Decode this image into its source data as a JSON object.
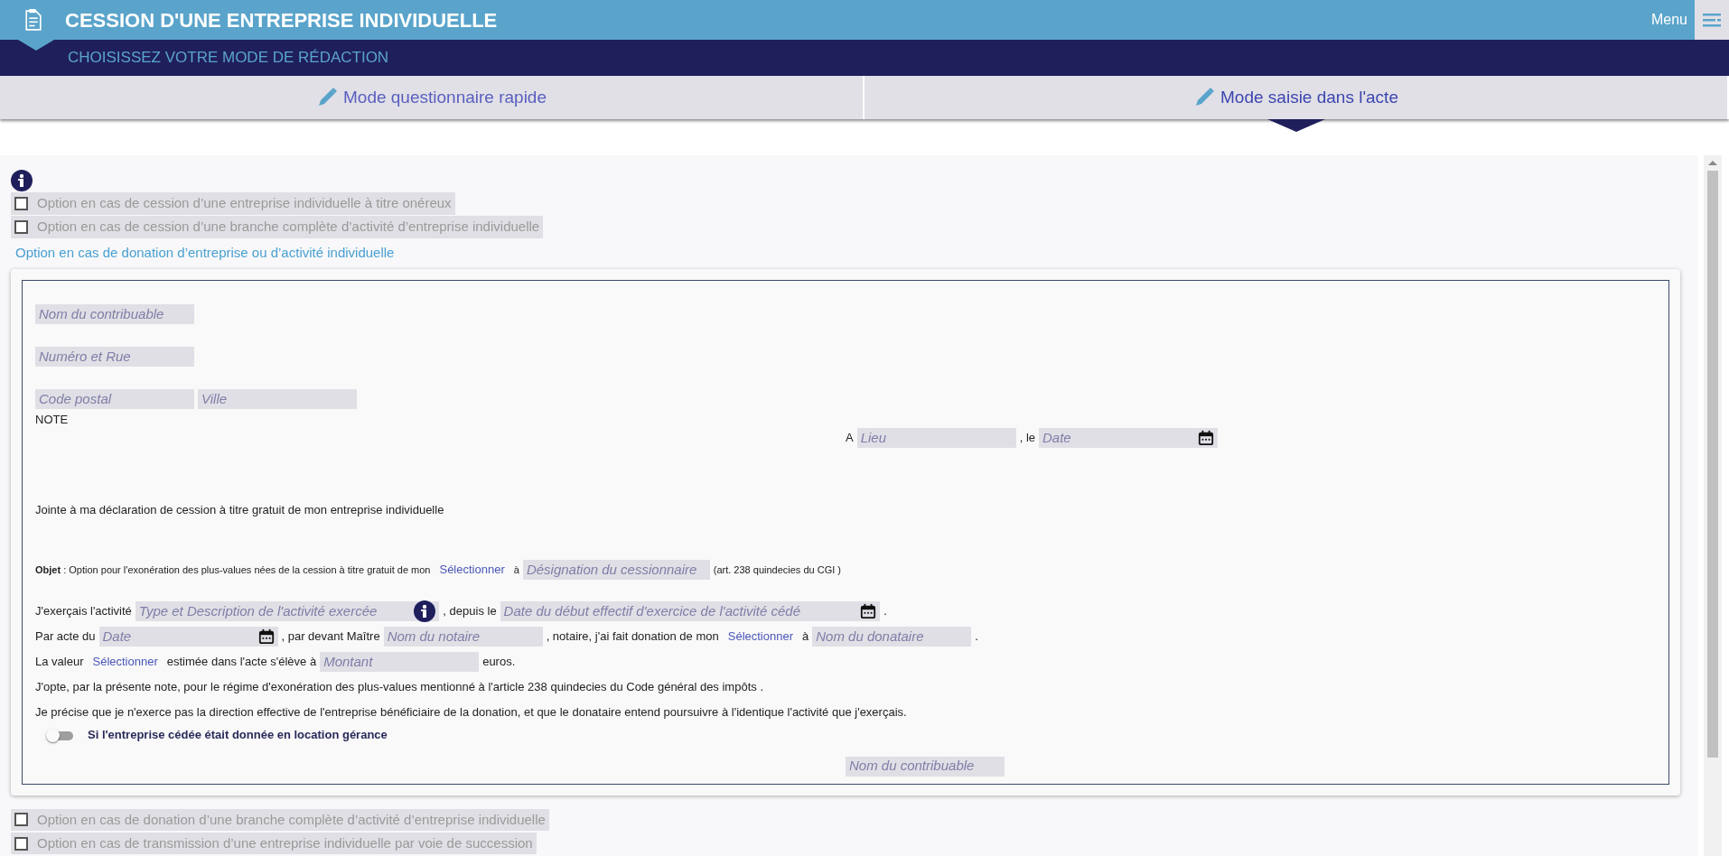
{
  "header": {
    "title": "CESSION D'UNE ENTREPRISE INDIVIDUELLE",
    "menu_label": "Menu"
  },
  "subheader": "CHOISISSEZ VOTRE MODE DE RÉDACTION",
  "tabs": [
    {
      "label": "Mode questionnaire rapide",
      "selected": false
    },
    {
      "label": "Mode saisie dans l'acte",
      "selected": true
    }
  ],
  "options_before": [
    {
      "label": "Option en cas de cession d’une entreprise individuelle à titre onéreux",
      "checked": false
    },
    {
      "label": "Option en cas de cession d’une branche complète d’activité d’entreprise individuelle",
      "checked": false
    }
  ],
  "section_title": "Option en cas de donation d’entreprise ou d’activité individuelle",
  "form": [
    {
      "kind": "fields",
      "segments": [
        {
          "kind": "field",
          "placeholder": "Nom du contribuable"
        }
      ]
    },
    {
      "kind": "fields",
      "segments": [
        {
          "kind": "field",
          "placeholder": "Numéro et Rue"
        }
      ]
    },
    {
      "kind": "fields",
      "segments": [
        {
          "kind": "field",
          "placeholder": "Code postal"
        },
        {
          "kind": "field",
          "placeholder": "Ville"
        }
      ]
    },
    {
      "kind": "heading",
      "segments": [
        {
          "kind": "text",
          "text": "NOTE"
        }
      ]
    },
    {
      "kind": "place_date",
      "segments": [
        {
          "kind": "text",
          "text": "A"
        },
        {
          "kind": "field",
          "placeholder": "Lieu"
        },
        {
          "kind": "text",
          "text": ", le"
        },
        {
          "kind": "date",
          "placeholder": "Date"
        }
      ]
    },
    {
      "kind": "intro",
      "segments": [
        {
          "kind": "text",
          "text": "Jointe à ma déclaration de cession à titre gratuit de mon entreprise individuelle"
        }
      ]
    },
    {
      "kind": "subject",
      "segments": [
        {
          "kind": "text",
          "text": "**Objet** : Option pour l'exonération des plus-values nées de la cession à titre gratuit de mon"
        },
        {
          "kind": "select",
          "text": "Sélectionner"
        },
        {
          "kind": "text",
          "text": "à"
        },
        {
          "kind": "field",
          "placeholder": "Désignation du cessionnaire"
        },
        {
          "kind": "text",
          "text": "(art. 238 quindecies du CGI )"
        }
      ]
    },
    {
      "kind": "paragraph",
      "segments": [
        {
          "kind": "text",
          "text": "J'exerçais l'activité"
        },
        {
          "kind": "info_field",
          "placeholder": "Type et Description de l'activité exercée"
        },
        {
          "kind": "text",
          "text": ", depuis le"
        },
        {
          "kind": "date",
          "placeholder": "Date du début effectif d'exercice de l'activité cédé"
        },
        {
          "kind": "text",
          "text": "."
        }
      ]
    },
    {
      "kind": "paragraph",
      "segments": [
        {
          "kind": "text",
          "text": "Par acte du"
        },
        {
          "kind": "date",
          "placeholder": "Date"
        },
        {
          "kind": "text",
          "text": ", par devant Maître"
        },
        {
          "kind": "field",
          "placeholder": "Nom du notaire"
        },
        {
          "kind": "text",
          "text": ", notaire, j'ai fait donation de mon"
        },
        {
          "kind": "select",
          "text": "Sélectionner"
        },
        {
          "kind": "text",
          "text": "à"
        },
        {
          "kind": "field",
          "placeholder": "Nom du donataire"
        },
        {
          "kind": "text",
          "text": "."
        }
      ]
    },
    {
      "kind": "paragraph",
      "segments": [
        {
          "kind": "text",
          "text": "La valeur"
        },
        {
          "kind": "select",
          "text": "Sélectionner"
        },
        {
          "kind": "text",
          "text": "estimée dans l'acte s'élève à"
        },
        {
          "kind": "field",
          "placeholder": "Montant"
        },
        {
          "kind": "text",
          "text": "euros."
        }
      ]
    },
    {
      "kind": "paragraph",
      "segments": [
        {
          "kind": "text",
          "text": "J'opte, par la présente note, pour le régime d'exonération des plus-values mentionné à l'article 238 quindecies du Code général des impôts ."
        }
      ]
    },
    {
      "kind": "paragraph",
      "segments": [
        {
          "kind": "text",
          "text": "Je précise que je n'exerce pas la direction effective de l'entreprise bénéficiaire de la donation, et que le donataire entend poursuivre à l'identique l'activité que j'exerçais."
        }
      ]
    },
    {
      "kind": "toggle",
      "label": "Si l'entreprise cédée était donnée en location gérance",
      "on": false
    },
    {
      "kind": "signature",
      "segments": [
        {
          "kind": "field",
          "placeholder": "Nom du contribuable"
        }
      ]
    }
  ],
  "options_after": [
    {
      "label": "Option en cas de donation d’une branche complète d’activité d’entreprise individuelle",
      "checked": false
    },
    {
      "label": "Option en cas de transmission d’une entreprise individuelle par voie de succession",
      "checked": false
    }
  ]
}
